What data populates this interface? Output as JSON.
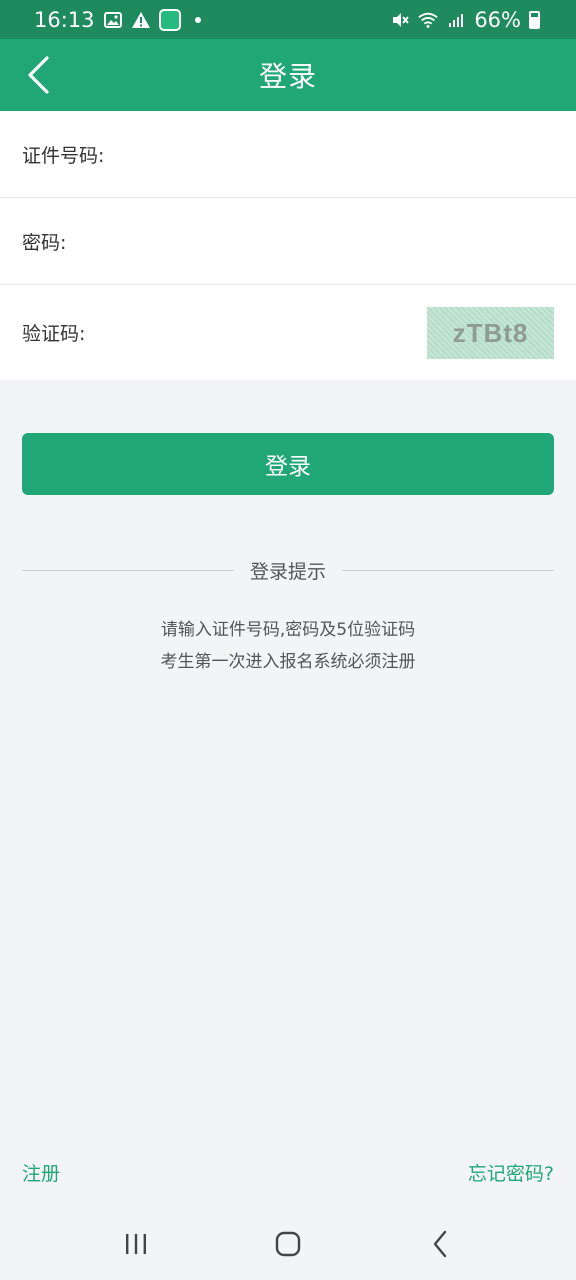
{
  "status_bar": {
    "time": "16:13",
    "battery_text": "66%"
  },
  "header": {
    "title": "登录",
    "back_icon": "chevron-left-icon"
  },
  "form": {
    "id_label": "证件号码:",
    "password_label": "密码:",
    "captcha_label": "验证码:",
    "captcha_text": "zTBt8"
  },
  "login_button": {
    "label": "登录"
  },
  "hint": {
    "title": "登录提示",
    "line1": "请输入证件号码,密码及5位验证码",
    "line2": "考生第一次进入报名系统必须注册"
  },
  "footer": {
    "register_label": "注册",
    "forgot_label": "忘记密码?"
  },
  "colors": {
    "primary": "#21a777",
    "status_bar": "#1e8a5e",
    "background": "#f3f4f6"
  }
}
